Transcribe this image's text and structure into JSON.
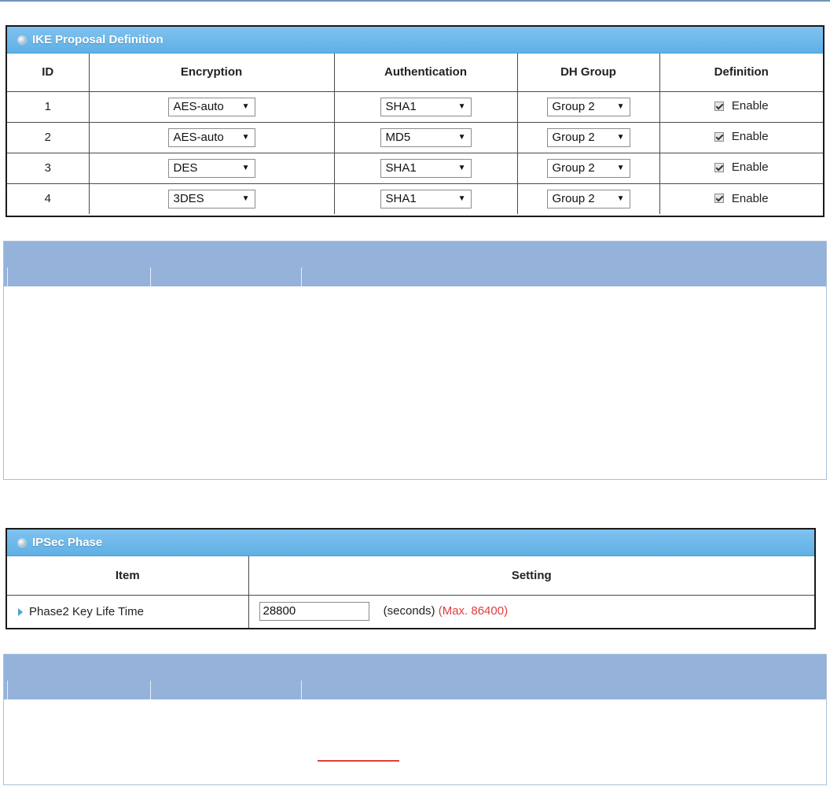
{
  "ike_panel": {
    "title": "IKE Proposal Definition",
    "headers": [
      "ID",
      "Encryption",
      "Authentication",
      "DH Group",
      "Definition"
    ],
    "rows": [
      {
        "id": "1",
        "encryption": "AES-auto",
        "authentication": "SHA1",
        "dh_group": "Group 2",
        "checked": true,
        "enable_label": "Enable"
      },
      {
        "id": "2",
        "encryption": "AES-auto",
        "authentication": "MD5",
        "dh_group": "Group 2",
        "checked": true,
        "enable_label": "Enable"
      },
      {
        "id": "3",
        "encryption": "DES",
        "authentication": "SHA1",
        "dh_group": "Group 2",
        "checked": true,
        "enable_label": "Enable"
      },
      {
        "id": "4",
        "encryption": "3DES",
        "authentication": "SHA1",
        "dh_group": "Group 2",
        "checked": true,
        "enable_label": "Enable"
      }
    ]
  },
  "ipsec_panel": {
    "title": "IPSec Phase",
    "headers": [
      "Item",
      "Setting"
    ],
    "row": {
      "item_label": "Phase2 Key Life Time",
      "value": "28800",
      "unit": "(seconds)",
      "max_note": "(Max. 86400)"
    }
  },
  "colors": {
    "panel_header": "#5fb0e6",
    "desc_header": "#95b3da",
    "max_note": "#e23c3c"
  }
}
